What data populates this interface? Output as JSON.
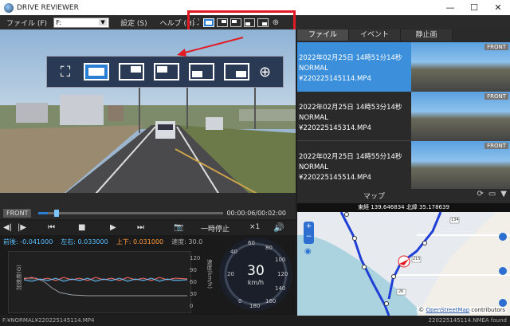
{
  "window": {
    "title": "DRIVE REVIEWER",
    "buttons": [
      "—",
      "☐",
      "✕"
    ]
  },
  "menu": {
    "file": "ファイル (F)",
    "drive": "F:",
    "settings": "設定 (S)",
    "help": "ヘルプ (H)"
  },
  "video": {
    "front_label": "FRONT",
    "time": "00:00:06/00:02:00",
    "progress": 0.05,
    "pause_label": "一時停止",
    "speed_label": "×1"
  },
  "gsensor": {
    "front_back": "前後: -0.041000",
    "left_right": "左右: 0.033000",
    "up_down": "上下: 0.031000",
    "speed": "速度: 30.0",
    "left_axis_label": "加速度(G)",
    "right_axis_label": "速度(km/h)",
    "right_ticks": [
      "120",
      "90",
      "60",
      "30",
      "0"
    ]
  },
  "speedometer": {
    "value": "30",
    "unit": "km/h",
    "ticks": [
      "60",
      "80",
      "100",
      "120",
      "140",
      "160",
      "180",
      "0",
      "20",
      "40"
    ]
  },
  "right_panel": {
    "tabs": [
      "ファイル",
      "イベント",
      "静止画"
    ],
    "files": [
      {
        "datetime": "2022年02月25日 14時51分14秒",
        "type": "NORMAL",
        "name": "¥220225145114.MP4",
        "tag": "FRONT"
      },
      {
        "datetime": "2022年02月25日 14時53分14秒",
        "type": "NORMAL",
        "name": "¥220225145314.MP4",
        "tag": "FRONT"
      },
      {
        "datetime": "2022年02月25日 14時55分14秒",
        "type": "NORMAL",
        "name": "¥220225145514.MP4",
        "tag": "FRONT"
      }
    ],
    "map_label": "マップ",
    "coords": "東経 139.646834 北緯 35.178639",
    "attribution_prefix": "© ",
    "attribution_link": "OpenStreetMap",
    "attribution_suffix": " contributors",
    "road_labels": [
      "215",
      "134",
      "26"
    ]
  },
  "status": {
    "left": "F:¥NORMAL¥220225145114.MP4",
    "right": "220225145114.NMEA found"
  },
  "colors": {
    "accent": "#2a7fd4",
    "highlight_box": "#e01b24",
    "selected_row": "#3b8fdb",
    "route": "#1f3fd6",
    "g_front_back": "#ff6b6b",
    "g_left_right": "#5bc0ff",
    "g_up_down": "#ff9a3c",
    "g_speed": "#9aa0a6"
  }
}
